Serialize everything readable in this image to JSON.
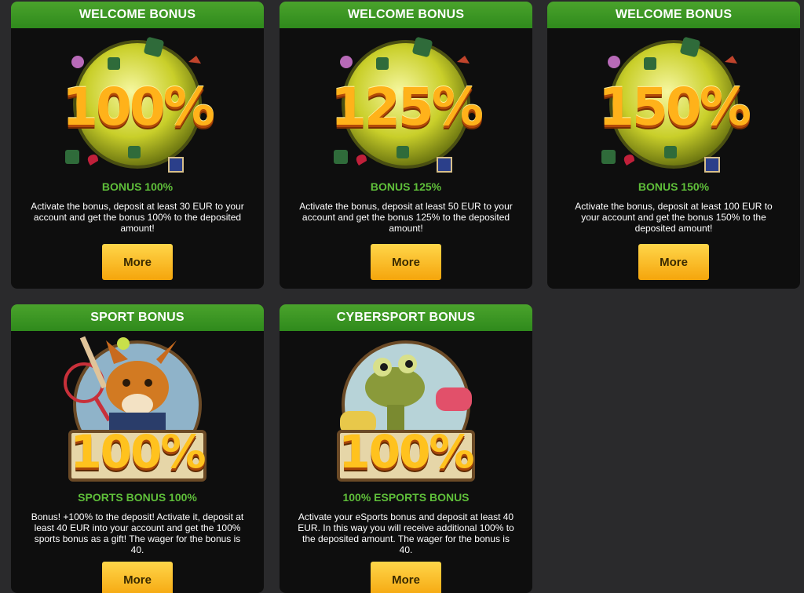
{
  "cards": [
    {
      "header": "WELCOME BONUS",
      "percent": "100%",
      "title": "BONUS 100%",
      "description": "Activate the bonus, deposit at least 30 EUR to your account and get the bonus 100% to the deposited amount!",
      "button": "More"
    },
    {
      "header": "WELCOME BONUS",
      "percent": "125%",
      "title": "BONUS 125%",
      "description": "Activate the bonus, deposit at least 50 EUR to your account and get the bonus 125% to the deposited amount!",
      "button": "More"
    },
    {
      "header": "WELCOME BONUS",
      "percent": "150%",
      "title": "BONUS 150%",
      "description": "Activate the bonus, deposit at least 100 EUR to your account and get the bonus 150% to the deposited amount!",
      "button": "More"
    },
    {
      "header": "SPORT BONUS",
      "percent": "100%",
      "title": "SPORTS BONUS 100%",
      "description": "Bonus! +100% to the deposit! Activate it, deposit at least 40 EUR into your account and get the 100% sports bonus as a gift! The wager for the bonus is 40.",
      "button": "More"
    },
    {
      "header": "CYBERSPORT BONUS",
      "percent": "100%",
      "title": "100% ESPORTS BONUS",
      "description": "Activate your eSports bonus and deposit at least 40 EUR. In this way you will receive additional 100% to the deposited amount. The wager for the bonus is 40.",
      "button": "More"
    }
  ],
  "colors": {
    "header_green": "#3a9a24",
    "title_green": "#5fbf3a",
    "button_gold": "#f5b520",
    "card_bg": "#0e0e0e",
    "page_bg": "#2a2a2c"
  }
}
